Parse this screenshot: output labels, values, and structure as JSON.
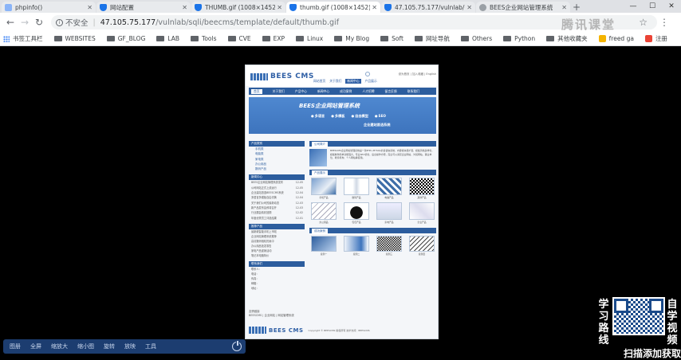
{
  "browser": {
    "tabs": [
      {
        "title": "phpinfo()",
        "icon": "doc-icon",
        "active": false
      },
      {
        "title": "网站配置",
        "icon": "shield-icon",
        "active": false
      },
      {
        "title": "THUMB.gif (1008×1452)",
        "icon": "shield-icon",
        "active": false
      },
      {
        "title": "thumb.gif (1008×1452)",
        "icon": "shield-icon",
        "active": true
      },
      {
        "title": "47.105.75.177/vulnlab/",
        "icon": "shield-icon",
        "active": false
      },
      {
        "title": "BEES企业网站管理系统",
        "icon": "globe-icon",
        "active": false
      }
    ],
    "address": {
      "security": "不安全",
      "separator": "|",
      "host": "47.105.75.177",
      "path": "/vulnlab/sqli/beecms/template/default/thumb.gif"
    },
    "bookmarks": [
      "书签工具栏",
      "WEBSITES",
      "GF_BLOG",
      "LAB",
      "Tools",
      "CVE",
      "EXP",
      "Linux",
      "My Blog",
      "Soft",
      "网址导航",
      "Others",
      "Python",
      "其他收藏夹",
      "freed ga",
      "注册"
    ]
  },
  "watermark": "腾讯课堂",
  "site": {
    "logo": "BEES CMS",
    "top_links": "设为首页 | 加入收藏 | English",
    "header_nav": [
      "网站首页",
      "关于我们",
      "新闻中心",
      "产品展示"
    ],
    "nav": [
      "首页",
      "关于我们",
      "产品中心",
      "新闻中心",
      "成功案例",
      "人才招聘",
      "留言反馈",
      "联系我们"
    ],
    "banner": {
      "title": "BEES企业网站管理系统",
      "tags": [
        "多语言",
        "多模板",
        "自由模型",
        "SEO"
      ],
      "subtitle": "企业建站首选系统"
    },
    "sidebar": {
      "products_head": "产品类别",
      "products": [
        "手机类",
        "电脑类",
        "家电类",
        "办公用品",
        "数码产品"
      ],
      "news_head": "新闻中心",
      "news": [
        {
          "title": "BEES企业网站管理系统发布",
          "date": "12-05"
        },
        {
          "title": "公司网站正式上线运行",
          "date": "12-05"
        },
        {
          "title": "企业建站首选BEESCMS系统",
          "date": "12-04"
        },
        {
          "title": "多语言多模板自由切换",
          "date": "12-04"
        },
        {
          "title": "关于我们公司的最新动态",
          "date": "12-03"
        },
        {
          "title": "新产品发布会即将召开",
          "date": "12-03"
        },
        {
          "title": "行业展会精彩回顾",
          "date": "12-02"
        },
        {
          "title": "年度优秀员工评选结果",
          "date": "12-01"
        }
      ],
      "recommend_head": "推荐产品",
      "recommend": [
        "最新款智能手机上市啦",
        "企业网站管理系统推荐",
        "高清数码相机热卖中",
        "办公用品批发零售",
        "家电产品促销活动",
        "笔记本电脑特价"
      ],
      "contact_head": "联系我们",
      "contact": [
        "联系人：",
        "电话：",
        "传真：",
        "邮箱：",
        "地址："
      ]
    },
    "main": {
      "about_head": "公司简介",
      "about_text": "BEESCMS企业网站管理系统是一款PHP+MYSQL的多语言系统，内容模块易扩展，模板风格多样化，模板制作简单功能强大，专业SEO优化，后台操作方便，完全可以满足企业网站、外贸网站、事业单位、教育机构、个人网站等使用。",
      "products_head": "产品展示",
      "products": [
        "手机产品",
        "数码产品",
        "电脑产品",
        "其他产品",
        "办公用品",
        "包包产品",
        "家电产品",
        "企业产品"
      ],
      "cases_head": "成功案例",
      "cases": [
        "案例一",
        "案例二",
        "案例三",
        "案例四"
      ]
    },
    "links_head": "友情链接",
    "links": "BEESCMS | 企业网站 | 网站管理系统",
    "footer": "Copyright © BEESCMS 版权所有 技术支持：BEESCMS"
  },
  "viewer_toolbar": [
    "图册",
    "全屏",
    "缩放大",
    "缩小图",
    "旋转",
    "放映",
    "工具"
  ],
  "promo": {
    "left": [
      "学",
      "习",
      "路",
      "线"
    ],
    "right": [
      "自",
      "学",
      "视",
      "频"
    ],
    "bottom": "扫描添加获取"
  }
}
